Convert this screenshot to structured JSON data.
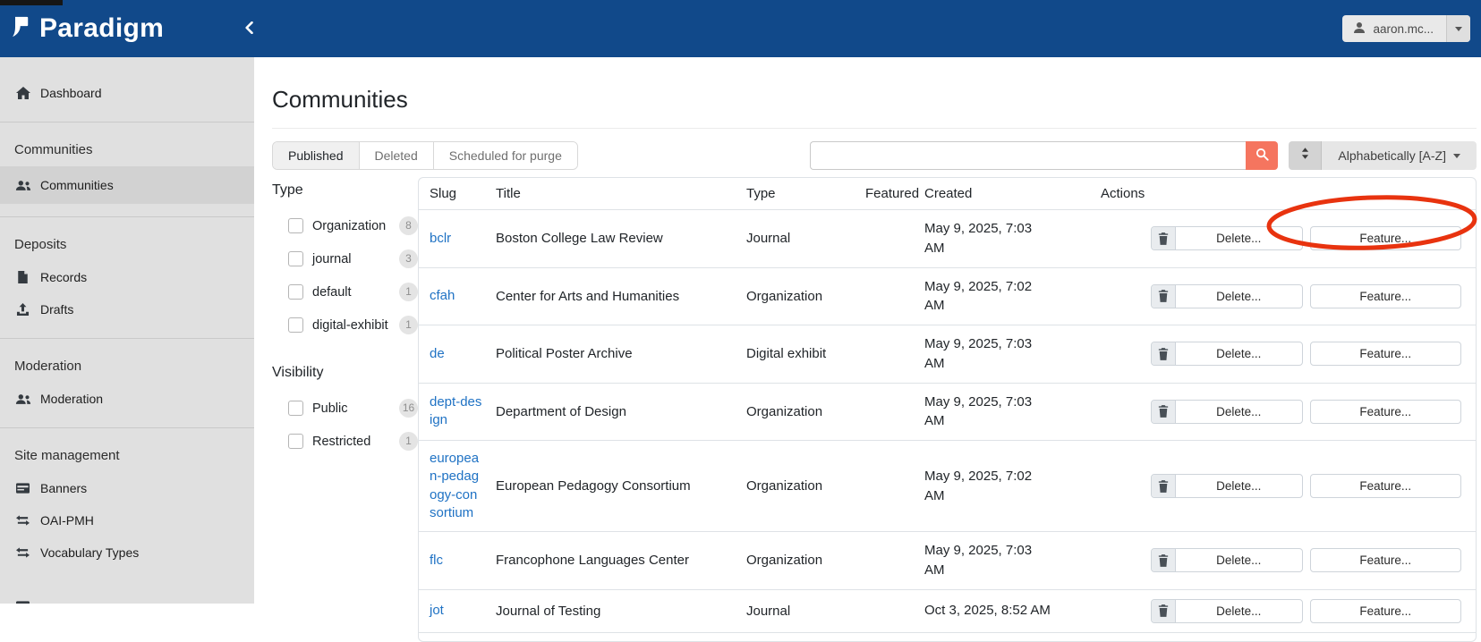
{
  "header": {
    "brand": "Paradigm",
    "user_label": "aaron.mc..."
  },
  "sidebar": {
    "sections": [
      {
        "items": [
          {
            "icon": "home-icon",
            "label": "Dashboard"
          }
        ]
      },
      {
        "header": "Communities",
        "items": [
          {
            "icon": "users-icon",
            "label": "Communities",
            "active": true
          }
        ]
      },
      {
        "header": "Deposits",
        "items": [
          {
            "icon": "file-icon",
            "label": "Records"
          },
          {
            "icon": "upload-icon",
            "label": "Drafts"
          }
        ]
      },
      {
        "header": "Moderation",
        "items": [
          {
            "icon": "users-icon",
            "label": "Moderation"
          }
        ]
      },
      {
        "header": "Site management",
        "items": [
          {
            "icon": "banner-icon",
            "label": "Banners"
          },
          {
            "icon": "exchange-icon",
            "label": "OAI-PMH"
          },
          {
            "icon": "exchange-icon",
            "label": "Vocabulary Types"
          }
        ]
      }
    ]
  },
  "main": {
    "title": "Communities",
    "tabs": [
      {
        "label": "Published",
        "active": true
      },
      {
        "label": "Deleted",
        "active": false
      },
      {
        "label": "Scheduled for purge",
        "active": false
      }
    ],
    "search": {
      "value": "",
      "placeholder": ""
    },
    "sort": {
      "label": "Alphabetically [A-Z]"
    },
    "filters": {
      "type": {
        "title": "Type",
        "options": [
          {
            "label": "Organization",
            "count": "8",
            "checked": false
          },
          {
            "label": "journal",
            "count": "3",
            "checked": false
          },
          {
            "label": "default",
            "count": "1",
            "checked": false
          },
          {
            "label": "digital-exhibit",
            "count": "1",
            "checked": false
          }
        ]
      },
      "visibility": {
        "title": "Visibility",
        "options": [
          {
            "label": "Public",
            "count": "16",
            "checked": false
          },
          {
            "label": "Restricted",
            "count": "1",
            "checked": false
          }
        ]
      }
    },
    "table": {
      "columns": [
        "Slug",
        "Title",
        "Type",
        "Featured",
        "Created",
        "Actions"
      ],
      "action_labels": {
        "delete": "Delete...",
        "feature": "Feature..."
      },
      "rows": [
        {
          "slug": "bclr",
          "title": "Boston College Law Review",
          "type": "Journal",
          "featured": "",
          "created": "May 9, 2025, 7:03 AM"
        },
        {
          "slug": "cfah",
          "title": "Center for Arts and Humanities",
          "type": "Organization",
          "featured": "",
          "created": "May 9, 2025, 7:02 AM"
        },
        {
          "slug": "de",
          "title": "Political Poster Archive",
          "type": "Digital exhibit",
          "featured": "",
          "created": "May 9, 2025, 7:03 AM"
        },
        {
          "slug": "dept-design",
          "title": "Department of Design",
          "type": "Organization",
          "featured": "",
          "created": "May 9, 2025, 7:03 AM"
        },
        {
          "slug": "european-pedagogy-consortium",
          "title": "European Pedagogy Consortium",
          "type": "Organization",
          "featured": "",
          "created": "May 9, 2025, 7:02 AM"
        },
        {
          "slug": "flc",
          "title": "Francophone Languages Center",
          "type": "Organization",
          "featured": "",
          "created": "May 9, 2025, 7:03 AM"
        },
        {
          "slug": "jot",
          "title": "Journal of Testing",
          "type": "Journal",
          "featured": "",
          "created": "Oct 3, 2025, 8:52 AM"
        }
      ]
    },
    "annotation": {
      "shape": "ellipse",
      "color": "#e8330f",
      "note": "red circle around Feature button of first row"
    }
  },
  "colors": {
    "header_bg": "#11498a",
    "search_button": "#f5755f",
    "link": "#1f72c4",
    "annotation": "#e8330f"
  }
}
